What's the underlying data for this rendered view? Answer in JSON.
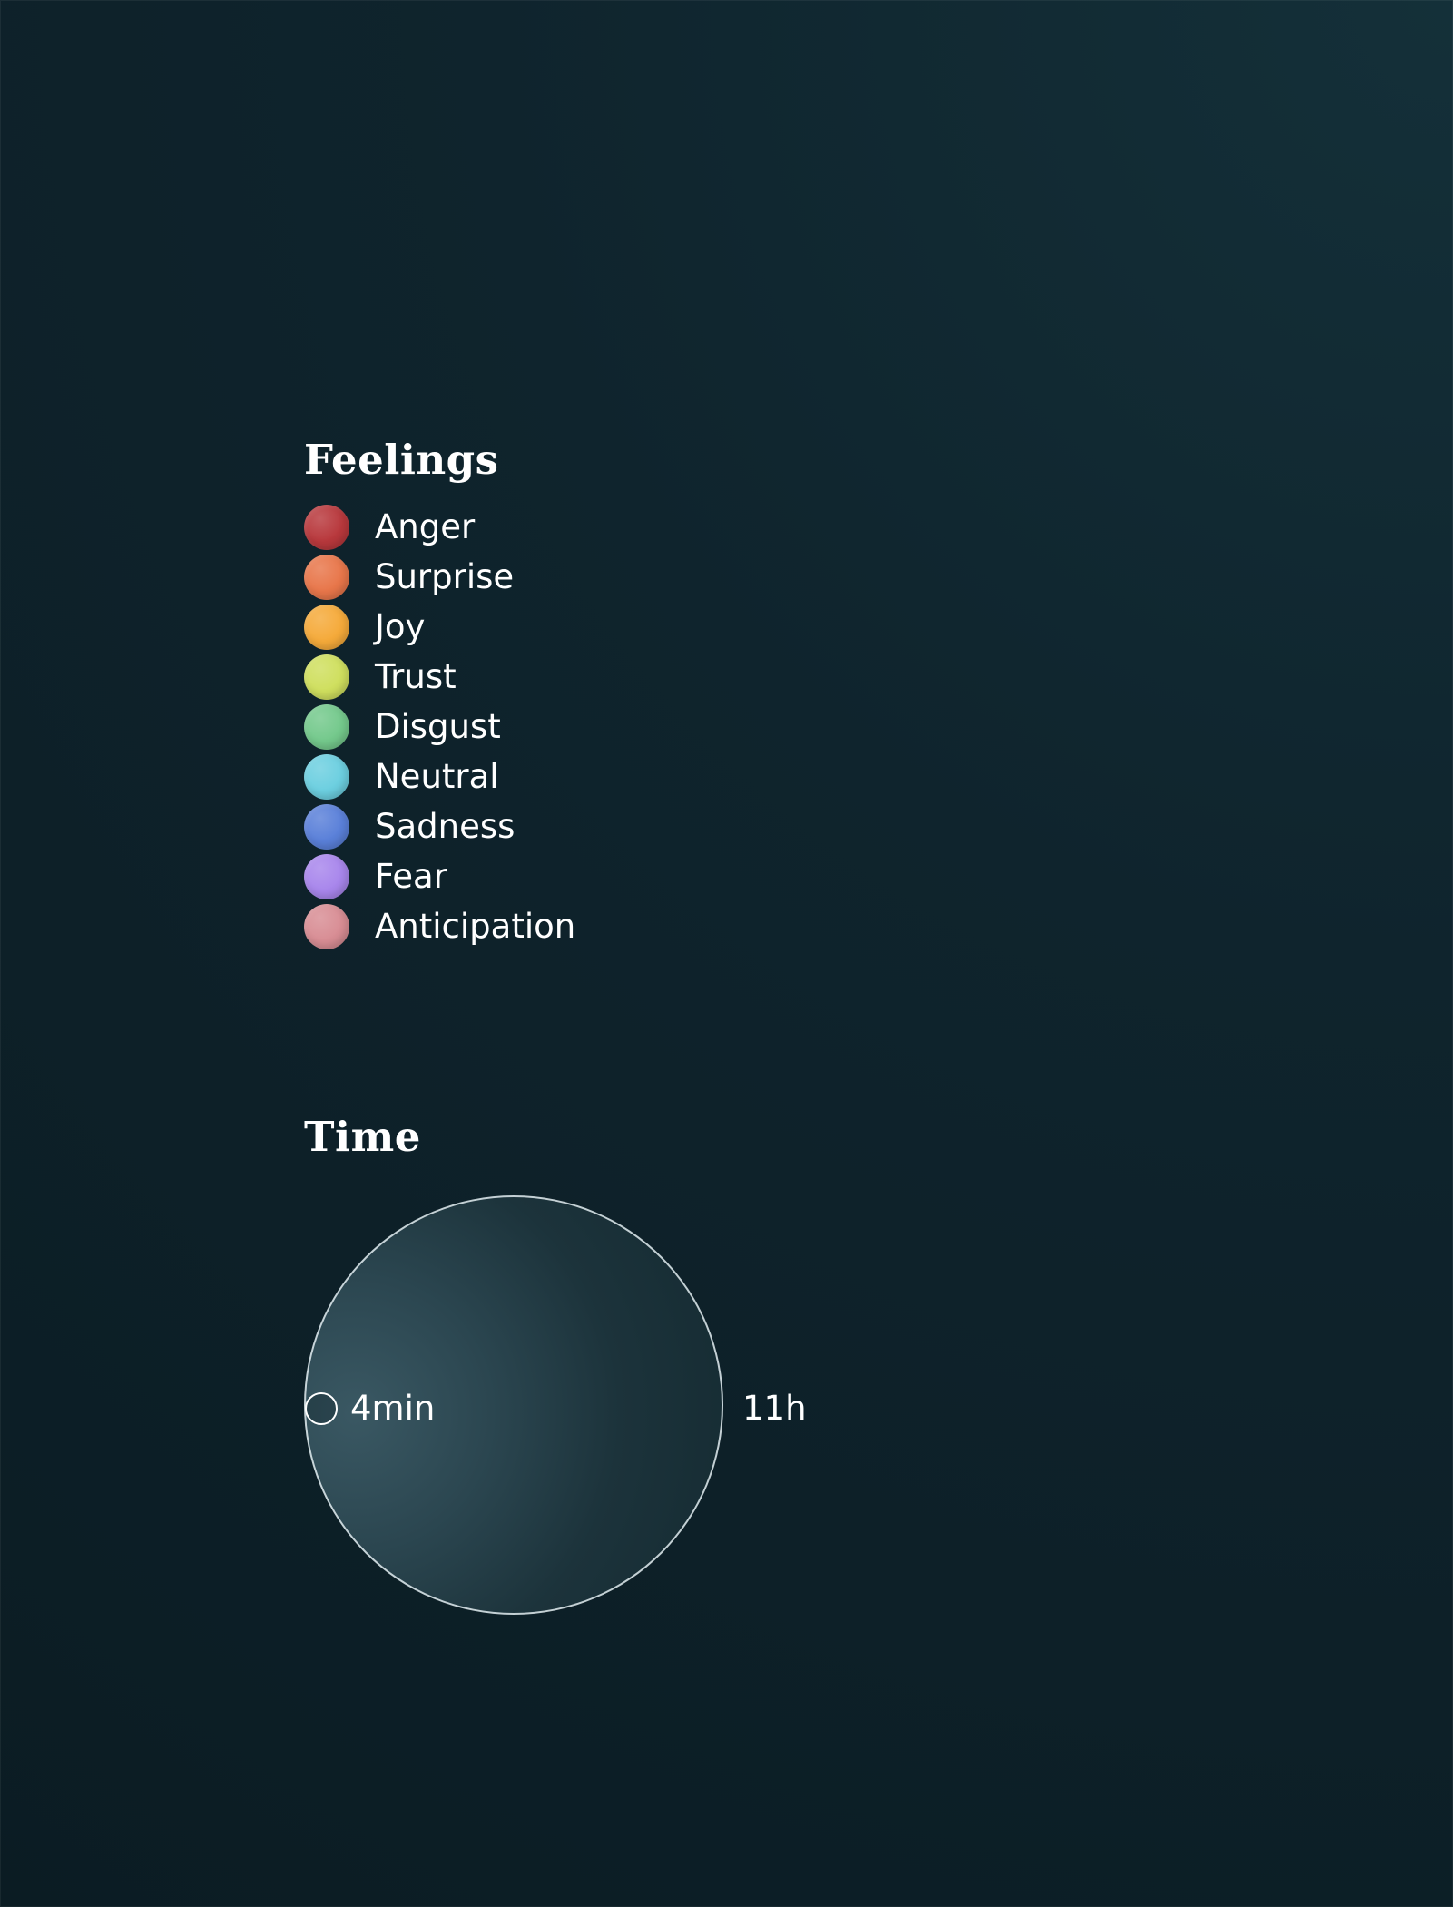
{
  "feelings": {
    "title": "Feelings",
    "items": [
      {
        "label": "Anger",
        "color": "#b8383c",
        "icon": "anger-color-dot"
      },
      {
        "label": "Surprise",
        "color": "#e8764a",
        "icon": "surprise-color-dot"
      },
      {
        "label": "Joy",
        "color": "#f5aa3a",
        "icon": "joy-color-dot"
      },
      {
        "label": "Trust",
        "color": "#cfdf5e",
        "icon": "trust-color-dot"
      },
      {
        "label": "Disgust",
        "color": "#74c98c",
        "icon": "disgust-color-dot"
      },
      {
        "label": "Neutral",
        "color": "#6ccfe0",
        "icon": "neutral-color-dot"
      },
      {
        "label": "Sadness",
        "color": "#5a80d9",
        "icon": "sadness-color-dot"
      },
      {
        "label": "Fear",
        "color": "#a886ec",
        "icon": "fear-color-dot"
      },
      {
        "label": "Anticipation",
        "color": "#d88d94",
        "icon": "anticipation-color-dot"
      }
    ]
  },
  "time": {
    "title": "Time",
    "min_label": "4min",
    "max_label": "11h",
    "circle_icon": "time-scale-circle",
    "marker_icon": "min-time-marker-circle"
  }
}
